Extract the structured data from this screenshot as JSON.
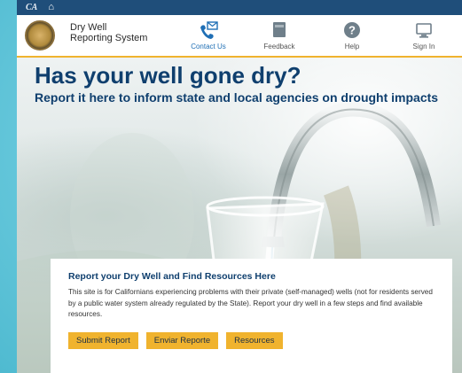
{
  "topbar": {
    "ca_label": "CA"
  },
  "brand": {
    "line1": "Dry Well",
    "line2": "Reporting System"
  },
  "nav": [
    {
      "label": "Contact Us",
      "icon": "mail-phone-icon"
    },
    {
      "label": "Feedback",
      "icon": "feedback-icon"
    },
    {
      "label": "Help",
      "icon": "help-icon"
    },
    {
      "label": "Sign In",
      "icon": "monitor-icon"
    }
  ],
  "hero": {
    "title": "Has your well gone dry?",
    "subtitle": "Report it here to inform state and local agencies on drought impacts"
  },
  "card": {
    "title": "Report your Dry Well and Find Resources Here",
    "body": "This site is for Californians experiencing problems with their private (self-managed) wells (not for residents served by a public water system already regulated by the State). Report your dry well in a few steps and find available resources.",
    "buttons": {
      "submit": "Submit Report",
      "enviar": "Enviar Reporte",
      "resources": "Resources"
    }
  },
  "colors": {
    "topbar": "#1f4e7a",
    "accent": "#f0b32e",
    "heading": "#0f3f6e",
    "link": "#1f6fb5"
  }
}
